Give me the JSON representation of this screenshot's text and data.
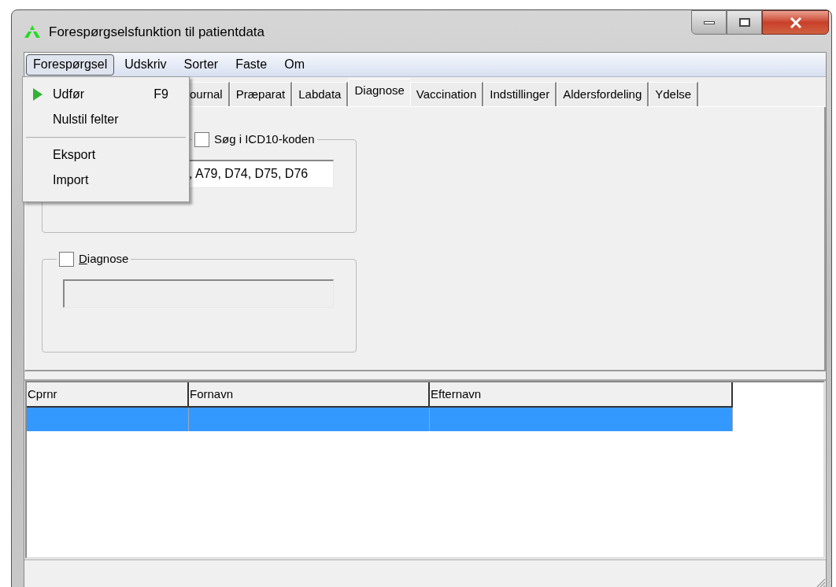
{
  "window": {
    "title": "Forespørgselsfunktion til patientdata"
  },
  "menu_bar": [
    {
      "label": "Forespørgsel",
      "selected": true
    },
    {
      "label": "Udskriv",
      "selected": false
    },
    {
      "label": "Sorter",
      "selected": false
    },
    {
      "label": "Faste",
      "selected": false
    },
    {
      "label": "Om",
      "selected": false
    }
  ],
  "dropdown": [
    {
      "kind": "run",
      "label": "Udfør",
      "shortcut": "F9"
    },
    {
      "kind": "command",
      "label": "Nulstil felter"
    },
    {
      "kind": "separator"
    },
    {
      "kind": "command",
      "label": "Eksport"
    },
    {
      "kind": "command",
      "label": "Import"
    }
  ],
  "tabs": [
    {
      "label": "ournal",
      "selected": false
    },
    {
      "label": "Præparat",
      "selected": false
    },
    {
      "label": "Labdata",
      "selected": false
    },
    {
      "label": "Diagnose",
      "selected": true
    },
    {
      "label": "Vaccination",
      "selected": false
    },
    {
      "label": "Indstillinger",
      "selected": false
    },
    {
      "label": "Aldersfordeling",
      "selected": false
    },
    {
      "label": "Ydelse",
      "selected": false
    }
  ],
  "groups": [
    {
      "label": "Søg i ICD10-koden",
      "checked": false,
      "underline_first": false,
      "value": ", A79, D74, D75, D76",
      "disabled": false
    },
    {
      "label": "Diagnose",
      "checked": false,
      "underline_first": true,
      "disabled": true
    }
  ],
  "table": {
    "columns": [
      "Cprnr",
      "Fornavn",
      "Efternavn"
    ],
    "rows": [
      {
        "selected": true
      }
    ]
  }
}
